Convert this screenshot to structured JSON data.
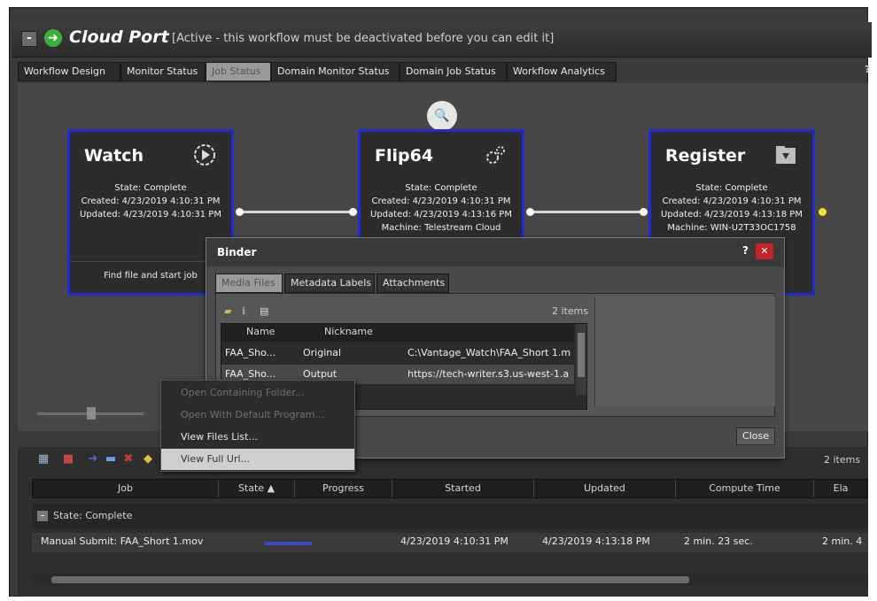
{
  "window": {
    "title": "Cloud Port",
    "subtitle": "[Active - this workflow must be deactivated before you can edit it]",
    "collapse_symbol": "-",
    "go_symbol": "➜"
  },
  "tabs": [
    "Workflow Design",
    "Monitor Status",
    "Job Status",
    "Domain Monitor Status",
    "Domain Job Status",
    "Workflow Analytics"
  ],
  "active_tab": "Job Status",
  "help": "?",
  "nodes": [
    {
      "title": "Watch",
      "icon": "play-circle-icon",
      "lines": [
        "State: Complete",
        "Created: 4/23/2019 4:10:31 PM",
        "Updated: 4/23/2019 4:10:31 PM"
      ],
      "footer": "Find file and start job"
    },
    {
      "title": "Flip64",
      "icon": "gears-icon",
      "lines": [
        "State: Complete",
        "Created: 4/23/2019 4:10:31 PM",
        "Updated: 4/23/2019 4:13:16 PM",
        "Machine: Telestream Cloud"
      ],
      "footer": ""
    },
    {
      "title": "Register",
      "icon": "folder-register-icon",
      "lines": [
        "State: Complete",
        "Created: 4/23/2019 4:10:31 PM",
        "Updated: 4/23/2019 4:13:18 PM",
        "Machine: WIN-U2T33OC1758"
      ],
      "footer": ""
    }
  ],
  "magnifier_symbol": "🔍",
  "binder": {
    "title": "Binder",
    "help": "?",
    "close_symbol": "✕",
    "tabs": [
      "Media Files",
      "Metadata Labels",
      "Attachments"
    ],
    "item_count": "2 items",
    "columns": [
      "Name",
      "Nickname"
    ],
    "rows": [
      {
        "name": "FAA_Sho...",
        "nickname": "Original",
        "path": "C:\\Vantage_Watch\\FAA_Short 1.m"
      },
      {
        "name": "FAA_Sho...",
        "nickname": "Output",
        "path": "https://tech-writer.s3.us-west-1.a"
      }
    ],
    "close_label": "Close"
  },
  "context_menu": {
    "items": [
      {
        "label": "Open Containing Folder...",
        "disabled": true
      },
      {
        "label": "Open With Default Program...",
        "disabled": true
      },
      {
        "label": "View Files List...",
        "disabled": false
      },
      {
        "label": "View Full Url...",
        "disabled": false,
        "hover": true
      }
    ]
  },
  "job_list": {
    "item_count": "2 items",
    "columns": [
      "Job",
      "State ▲",
      "Progress",
      "Started",
      "Updated",
      "Compute Time",
      "Ela"
    ],
    "group_label": "State: Complete",
    "group_symbol": "-",
    "rows": [
      {
        "job": "Manual Submit: FAA_Short 1.mov",
        "progress": 1.0,
        "started": "4/23/2019 4:10:31 PM",
        "updated": "4/23/2019 4:13:18 PM",
        "compute": "2 min. 23 sec.",
        "elapsed": "2 min. 4"
      }
    ]
  }
}
